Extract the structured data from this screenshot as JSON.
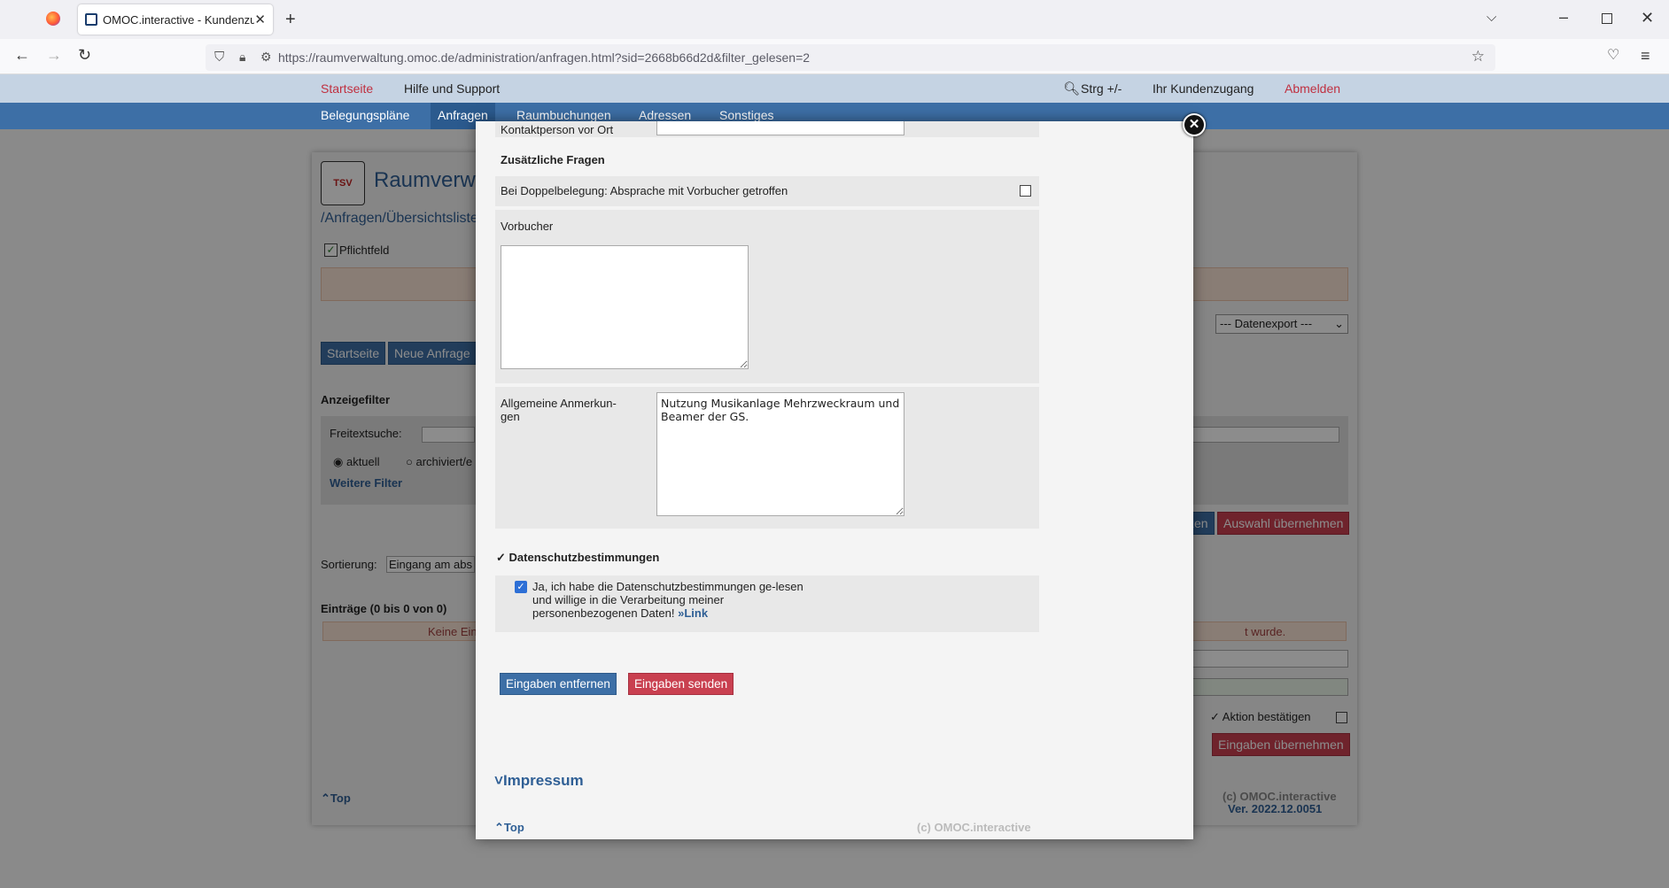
{
  "browser": {
    "tab_title": "OMOC.interactive - Kundenzugang",
    "url": "https://raumverwaltung.omoc.de/administration/anfragen.html?sid=2668b66d2d&filter_gelesen=2"
  },
  "topnav": {
    "home": "Startseite",
    "help": "Hilfe und Support",
    "zoom": "Strg +/-",
    "account": "Ihr Kundenzugang",
    "logout": "Abmelden"
  },
  "mainnav": {
    "items": [
      "Belegungspläne",
      "Anfragen",
      "Raumbuchungen",
      "Adressen",
      "Sonstiges"
    ]
  },
  "background": {
    "app_title": "Raumverwa",
    "breadcrumb": "/Anfragen/Übersichtsliste",
    "required_label": "Pflichtfeld",
    "export_select": "--- Datenexport ---",
    "btn_home": "Startseite",
    "btn_new": "Neue Anfrage",
    "filter_title": "Anzeigefilter",
    "freetext_label": "Freitextsuche:",
    "radio_current": "aktuell",
    "radio_archived": "archiviert/e",
    "more_filters": "Weitere Filter",
    "btn_partial": "zen",
    "btn_apply_selection": "Auswahl übernehmen",
    "sort_label": "Sortierung:",
    "sort_value": "Eingang am abs",
    "entries": "Einträge (0 bis 0 von 0)",
    "no_entries_left": "Keine Ein",
    "no_entries_right": "t wurde.",
    "confirm_action": "Aktion bestätigen",
    "btn_apply_input": "Eingaben übernehmen",
    "top_link": "Top",
    "copyright": "(c) OMOC.interactive",
    "version": "Ver. 2022.12.0051"
  },
  "modal": {
    "contact_label": "Kontaktperson vor Ort",
    "extra_questions": "Zusätzliche Fragen",
    "double_booking": "Bei Doppelbelegung: Absprache mit Vorbucher getroffen",
    "prev_booker": "Vorbucher",
    "prev_booker_value": "",
    "general_notes_label": "Allgemeine Anmerkun-gen",
    "general_notes_value": "Nutzung Musikanlage Mehrzweckraum und Beamer der GS.",
    "privacy_title": "Datenschutzbestimmungen",
    "privacy_text": "Ja, ich habe die Datenschutzbestimmungen ge-lesen und willige in die Verarbeitung meiner personenbezogenen Daten!",
    "privacy_link": "Link",
    "btn_clear": "Eingaben entfernen",
    "btn_send": "Eingaben senden",
    "impressum": "Impressum",
    "top_link": "Top",
    "copyright": "(c) OMOC.interactive"
  }
}
